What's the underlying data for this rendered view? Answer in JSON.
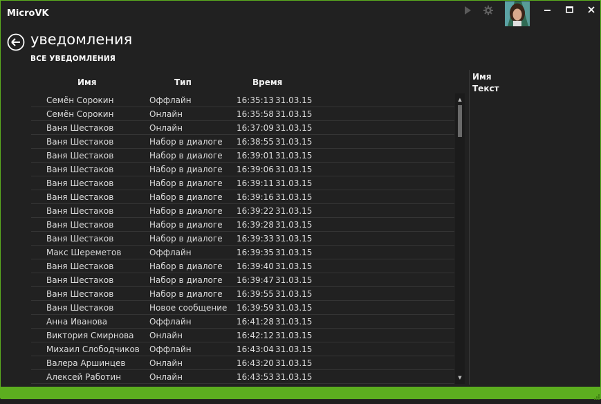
{
  "app": {
    "title": "MicroVK"
  },
  "titlebar": {
    "icons": [
      "play-icon",
      "gear-icon",
      "avatar",
      "minimize-icon",
      "maximize-icon",
      "close-icon"
    ]
  },
  "page": {
    "title": "уведомления",
    "section": "ВСЕ УВЕДОМЛЕНИЯ"
  },
  "table": {
    "columns": [
      "Имя",
      "Тип",
      "Время"
    ],
    "rows": [
      [
        "Семён Сорокин",
        "Оффлайн",
        "16:35:13",
        "31.03.15"
      ],
      [
        "Семён Сорокин",
        "Онлайн",
        "16:35:58",
        "31.03.15"
      ],
      [
        "Ваня Шестаков",
        "Онлайн",
        "16:37:09",
        "31.03.15"
      ],
      [
        "Ваня Шестаков",
        "Набор в диалоге",
        "16:38:55",
        "31.03.15"
      ],
      [
        "Ваня Шестаков",
        "Набор в диалоге",
        "16:39:01",
        "31.03.15"
      ],
      [
        "Ваня Шестаков",
        "Набор в диалоге",
        "16:39:06",
        "31.03.15"
      ],
      [
        "Ваня Шестаков",
        "Набор в диалоге",
        "16:39:11",
        "31.03.15"
      ],
      [
        "Ваня Шестаков",
        "Набор в диалоге",
        "16:39:16",
        "31.03.15"
      ],
      [
        "Ваня Шестаков",
        "Набор в диалоге",
        "16:39:22",
        "31.03.15"
      ],
      [
        "Ваня Шестаков",
        "Набор в диалоге",
        "16:39:28",
        "31.03.15"
      ],
      [
        "Ваня Шестаков",
        "Набор в диалоге",
        "16:39:33",
        "31.03.15"
      ],
      [
        "Макс Шереметов",
        "Оффлайн",
        "16:39:35",
        "31.03.15"
      ],
      [
        "Ваня Шестаков",
        "Набор в диалоге",
        "16:39:40",
        "31.03.15"
      ],
      [
        "Ваня Шестаков",
        "Набор в диалоге",
        "16:39:47",
        "31.03.15"
      ],
      [
        "Ваня Шестаков",
        "Набор в диалоге",
        "16:39:55",
        "31.03.15"
      ],
      [
        "Ваня Шестаков",
        "Новое сообщение",
        "16:39:59",
        "31.03.15"
      ],
      [
        "Анна Иванова",
        "Оффлайн",
        "16:41:28",
        "31.03.15"
      ],
      [
        "Виктория Смирнова",
        "Онлайн",
        "16:42:12",
        "31.03.15"
      ],
      [
        "Михаил Слободчиков",
        "Оффлайн",
        "16:43:04",
        "31.03.15"
      ],
      [
        "Валера Аршинцев",
        "Онлайн",
        "16:43:20",
        "31.03.15"
      ],
      [
        "Алексей Работин",
        "Онлайн",
        "16:43:53",
        "31.03.15"
      ]
    ]
  },
  "details": {
    "name_label": "Имя",
    "text_label": "Текст"
  },
  "colors": {
    "accent": "#5cae1f",
    "background": "#212121"
  }
}
